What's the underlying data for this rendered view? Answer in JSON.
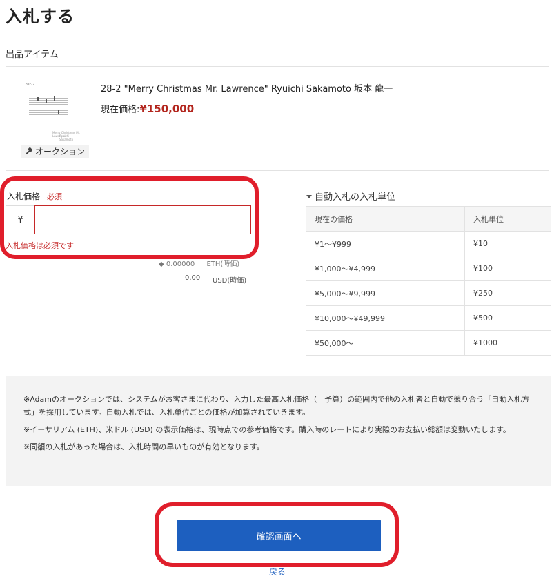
{
  "page": {
    "title": "入札する"
  },
  "item_section": {
    "label": "出品アイテム"
  },
  "item": {
    "thumbnail_label": "28F-2",
    "thumbnail_caption_1": "Merry Christmas Mr. Lawrence",
    "thumbnail_caption_2": "Ryuichi Sakamoto",
    "auction_tag": "オークション",
    "title": "28-2 \"Merry Christmas Mr. Lawrence\" Ryuichi Sakamoto 坂本 龍一",
    "price_label": "現在価格:",
    "price_value": "¥150,000"
  },
  "bid_form": {
    "label": "入札価格",
    "required": "必須",
    "currency": "¥",
    "value": "",
    "placeholder": "",
    "error": "入札価格は必須です",
    "eth_value": "0.00000",
    "eth_unit": "ETH(時価)",
    "usd_value": "0.00",
    "usd_unit": "USD(時価)"
  },
  "auto_bid": {
    "title": "自動入札の入札単位",
    "headers": [
      "現在の価格",
      "入札単位"
    ],
    "rows": [
      [
        "¥1～¥999",
        "¥10"
      ],
      [
        "¥1,000～¥4,999",
        "¥100"
      ],
      [
        "¥5,000～¥9,999",
        "¥250"
      ],
      [
        "¥10,000～¥49,999",
        "¥500"
      ],
      [
        "¥50,000～",
        "¥1000"
      ]
    ]
  },
  "notes": [
    "※Adamのオークションでは、システムがお客さまに代わり、入力した最高入札価格（＝予算）の範囲内で他の入札者と自動で競り合う「自動入札方式」を採用しています。自動入札では、入札単位ごとの価格が加算されていきます。",
    "※イーサリアム (ETH)、米ドル (USD) の表示価格は、現時点での参考価格です。購入時のレートにより実際のお支払い総額は変動いたします。",
    "※同額の入札があった場合は、入札時間の早いものが有効となります。"
  ],
  "actions": {
    "confirm": "確認画面へ",
    "back": "戻る"
  },
  "colors": {
    "accent": "#1d5fbf",
    "price": "#b3261e",
    "error": "#c62828",
    "highlight": "#e01e2b"
  }
}
